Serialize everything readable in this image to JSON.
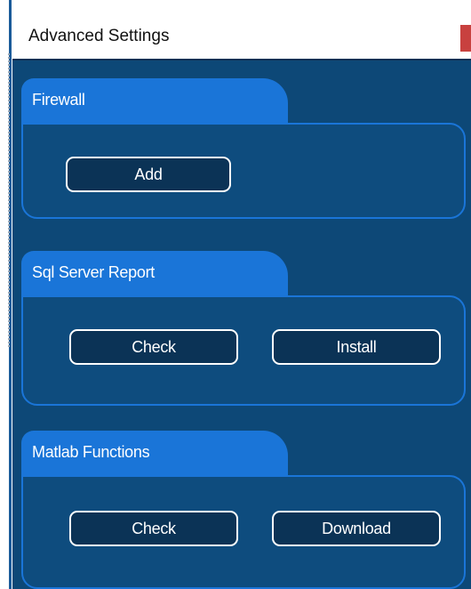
{
  "window": {
    "title": "Advanced Settings"
  },
  "groups": {
    "firewall": {
      "label": "Firewall",
      "buttons": {
        "add": "Add"
      }
    },
    "sql_report": {
      "label": "Sql Server Report",
      "buttons": {
        "check": "Check",
        "install": "Install"
      }
    },
    "matlab": {
      "label": "Matlab Functions",
      "buttons": {
        "check": "Check",
        "download": "Download"
      }
    }
  },
  "colors": {
    "panel_background": "#0d4877",
    "group_accent": "#1a75d8",
    "button_fill": "#0b3356",
    "button_border": "#ffffff",
    "close_accent": "#c8413f"
  }
}
